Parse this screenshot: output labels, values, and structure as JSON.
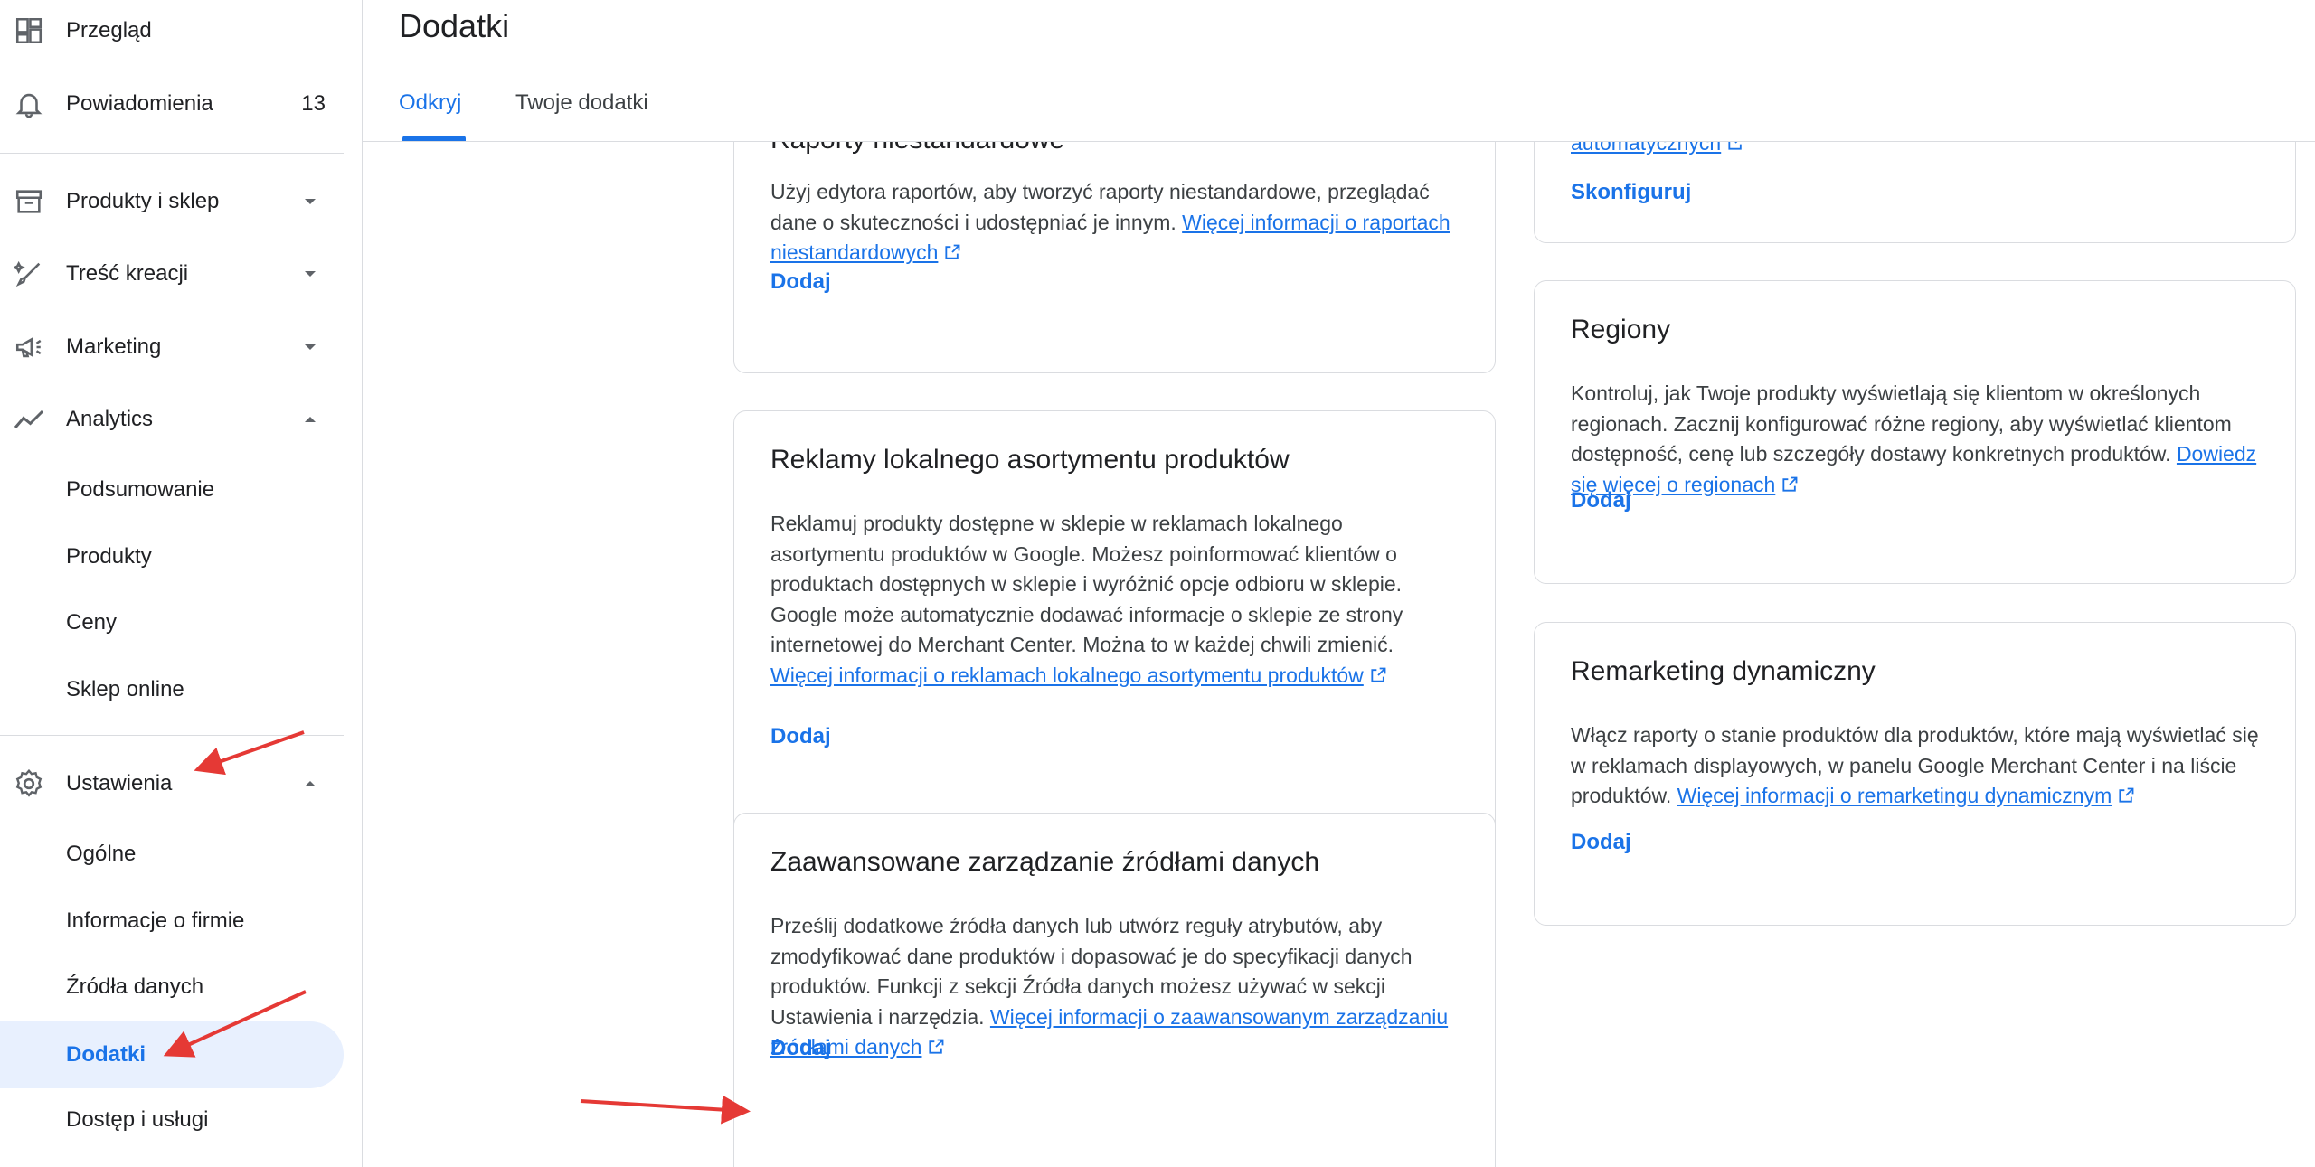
{
  "sidebar": {
    "items": [
      {
        "label": "Przegląd",
        "icon": "dashboard-icon"
      },
      {
        "label": "Powiadomienia",
        "icon": "bell-icon",
        "count": "13"
      },
      {
        "label": "Produkty i sklep",
        "icon": "store-icon"
      },
      {
        "label": "Treść kreacji",
        "icon": "brush-icon"
      },
      {
        "label": "Marketing",
        "icon": "megaphone-icon"
      },
      {
        "label": "Analytics",
        "icon": "trend-icon"
      },
      {
        "label": "Ustawienia",
        "icon": "gear-icon"
      }
    ],
    "analytics_sub": [
      "Podsumowanie",
      "Produkty",
      "Ceny",
      "Sklep online"
    ],
    "settings_sub": [
      "Ogólne",
      "Informacje o firmie",
      "Źródła danych",
      "Dodatki",
      "Dostęp i usługi"
    ]
  },
  "header": {
    "title": "Dodatki",
    "tabs": [
      "Odkryj",
      "Twoje dodatki"
    ]
  },
  "cards_left": [
    {
      "title": "Raporty niestandardowe",
      "desc": "Użyj edytora raportów, aby tworzyć raporty niestandardowe, przeglądać dane o skuteczności i udostępniać je innym.",
      "link": "Więcej informacji o raportach niestandardowych",
      "action": "Dodaj"
    },
    {
      "title": "Reklamy lokalnego asortymentu produktów",
      "desc": "Reklamuj produkty dostępne w sklepie w reklamach lokalnego asortymentu produktów w Google. Możesz poinformować klientów o produktach dostępnych w sklepie i wyróżnić opcje odbioru w sklepie. Google może automatycznie dodawać informacje o sklepie ze strony internetowej do Merchant Center. Można to w każdej chwili zmienić.",
      "link": "Więcej informacji o reklamach lokalnego asortymentu produktów",
      "action": "Dodaj"
    },
    {
      "title": "Zaawansowane zarządzanie źródłami danych",
      "desc": "Prześlij dodatkowe źródła danych lub utwórz reguły atrybutów, aby zmodyfikować dane produktów i dopasować je do specyfikacji danych produktów. Funkcji z sekcji Źródła danych możesz używać w sekcji Ustawienia i narzędzia.",
      "link": "Więcej informacji o zaawansowanym zarządzaniu źródłami danych",
      "action": "Dodaj"
    }
  ],
  "cards_right": [
    {
      "link": "automatycznych",
      "action": "Skonfiguruj"
    },
    {
      "title": "Regiony",
      "desc": "Kontroluj, jak Twoje produkty wyświetlają się klientom w określonych regionach. Zacznij konfigurować różne regiony, aby wyświetlać klientom dostępność, cenę lub szczegóły dostawy konkretnych produktów.",
      "link": "Dowiedz się więcej o regionach",
      "action": "Dodaj"
    },
    {
      "title": "Remarketing dynamiczny",
      "desc": "Włącz raporty o stanie produktów dla produktów, które mają wyświetlać się w reklamach displayowych, w panelu Google Merchant Center i na liście produktów.",
      "link": "Więcej informacji o remarketingu dynamicznym",
      "action": "Dodaj"
    }
  ],
  "colors": {
    "accent": "#1a73e8",
    "active_bg": "#e8f0fe",
    "arrow": "#e53935"
  }
}
